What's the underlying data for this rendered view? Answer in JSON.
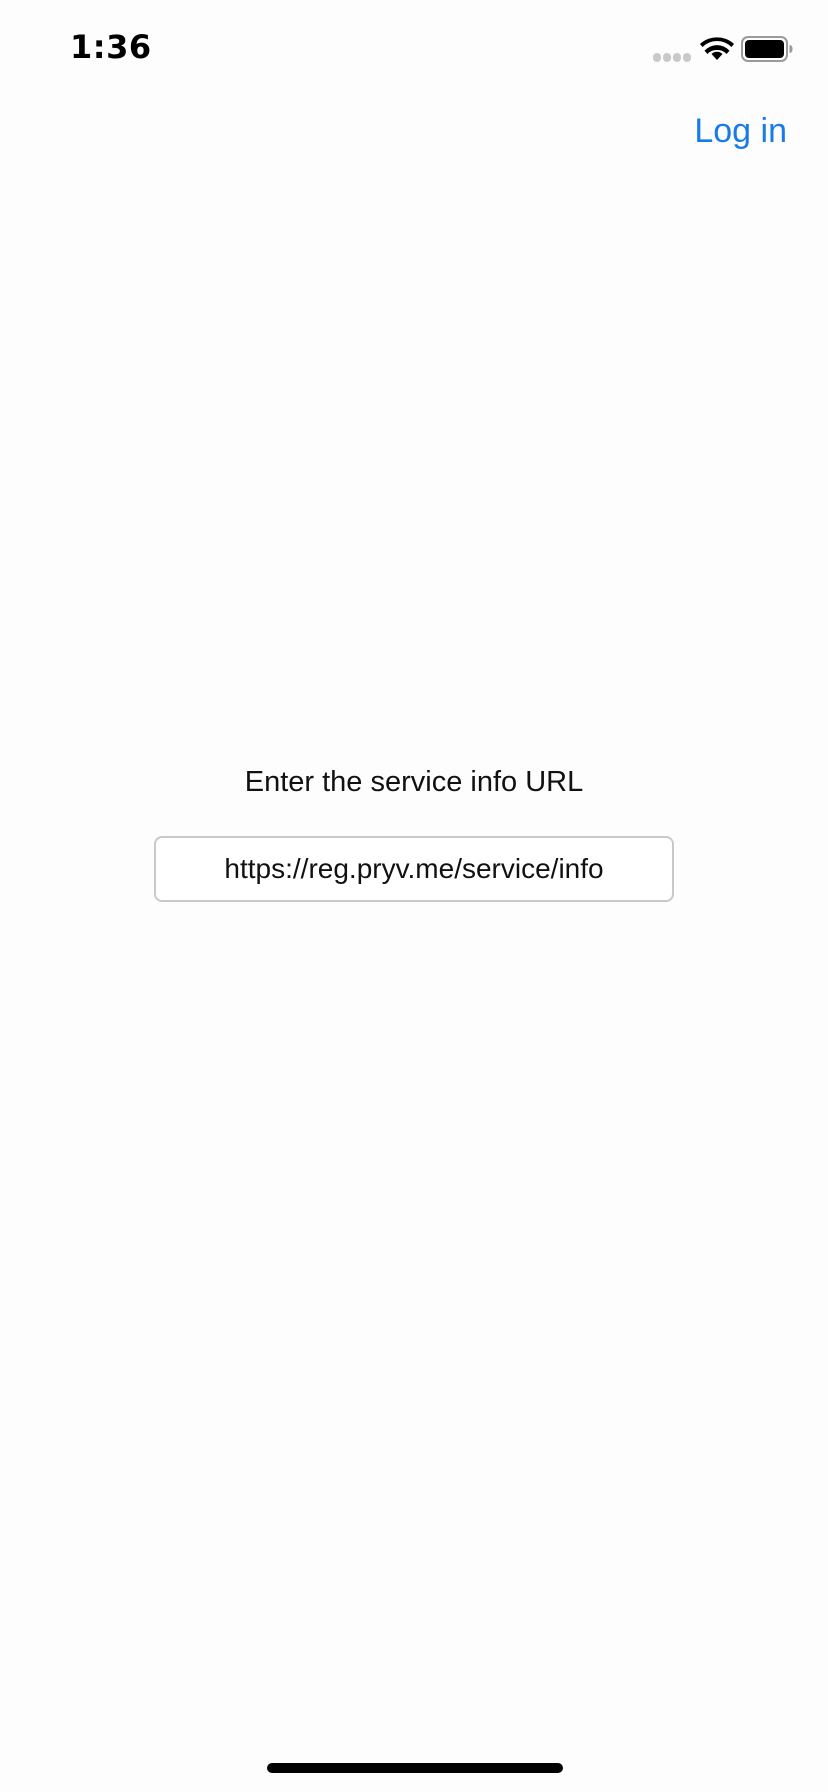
{
  "status_bar": {
    "time": "1:36",
    "icons": [
      "signal-icon",
      "wifi-icon",
      "battery-icon"
    ]
  },
  "nav_bar": {
    "login_label": "Log in"
  },
  "main": {
    "prompt": "Enter the service info URL",
    "url_input_value": "https://reg.pryv.me/service/info"
  },
  "colors": {
    "accent": "#1a7be8",
    "background": "#fdfdfd",
    "input_border": "#c9c9c9",
    "text": "#111111"
  }
}
